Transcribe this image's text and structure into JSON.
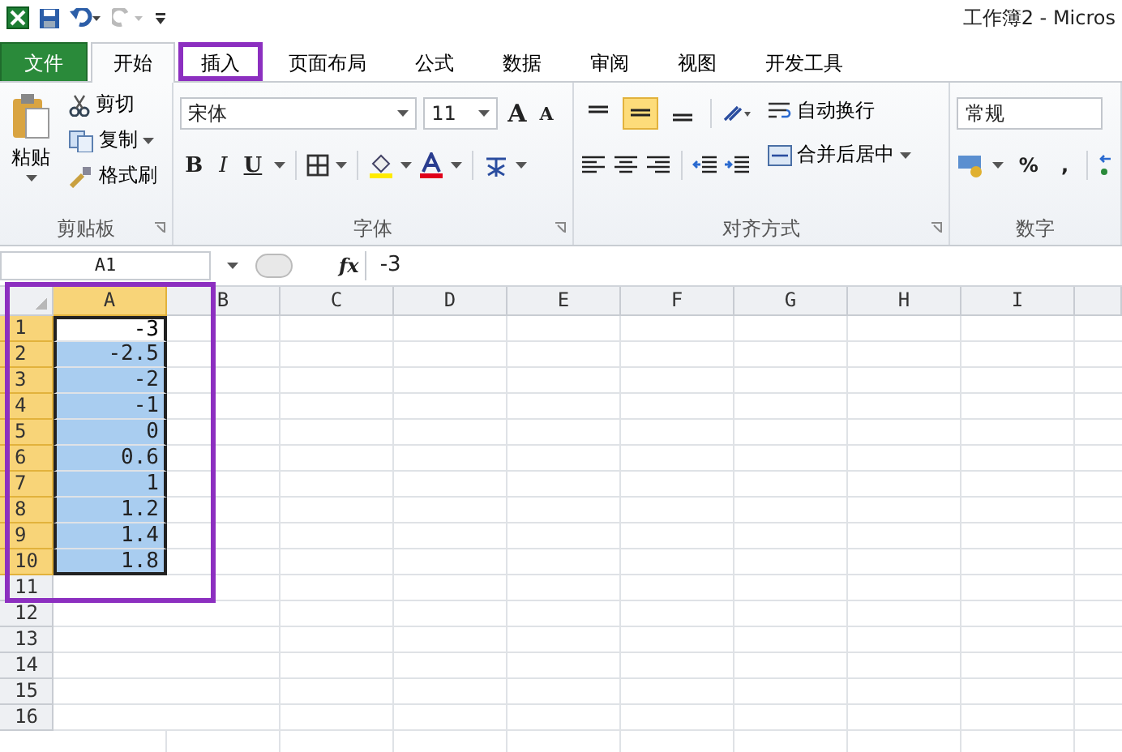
{
  "window": {
    "title": "工作簿2 - Micros"
  },
  "tabs": [
    {
      "label": "文件",
      "kind": "file",
      "selected": false,
      "highlighted": false
    },
    {
      "label": "开始",
      "kind": "tab",
      "selected": true,
      "highlighted": false
    },
    {
      "label": "插入",
      "kind": "tab",
      "selected": false,
      "highlighted": true
    },
    {
      "label": "页面布局",
      "kind": "tab",
      "selected": false,
      "highlighted": false
    },
    {
      "label": "公式",
      "kind": "tab",
      "selected": false,
      "highlighted": false
    },
    {
      "label": "数据",
      "kind": "tab",
      "selected": false,
      "highlighted": false
    },
    {
      "label": "审阅",
      "kind": "tab",
      "selected": false,
      "highlighted": false
    },
    {
      "label": "视图",
      "kind": "tab",
      "selected": false,
      "highlighted": false
    },
    {
      "label": "开发工具",
      "kind": "tab",
      "selected": false,
      "highlighted": false
    }
  ],
  "clipboard": {
    "paste": "粘贴",
    "cut": "剪切",
    "copy": "复制",
    "format_painter": "格式刷",
    "label": "剪贴板"
  },
  "font": {
    "name": "宋体",
    "size": "11",
    "grow": "A",
    "shrink": "A",
    "bold": "B",
    "italic": "I",
    "underline": "U",
    "label": "字体"
  },
  "alignment": {
    "wrap": "自动换行",
    "merge": "合并后居中",
    "label": "对齐方式",
    "align_buttons": [
      {
        "selected": false
      },
      {
        "selected": true
      },
      {
        "selected": false
      }
    ]
  },
  "number": {
    "format": "常规",
    "percent": "%",
    "comma": ",",
    "label": "数字"
  },
  "formula_bar": {
    "name_box": "A1",
    "fx": "fx",
    "value": "-3"
  },
  "sheet": {
    "columns": [
      {
        "label": "A",
        "selected": true
      },
      {
        "label": "B",
        "selected": false
      },
      {
        "label": "C",
        "selected": false
      },
      {
        "label": "D",
        "selected": false
      },
      {
        "label": "E",
        "selected": false
      },
      {
        "label": "F",
        "selected": false
      },
      {
        "label": "G",
        "selected": false
      },
      {
        "label": "H",
        "selected": false
      },
      {
        "label": "I",
        "selected": false
      }
    ],
    "highlight_frame": true,
    "rows": [
      {
        "label": "1",
        "value": "-3",
        "selected": true,
        "active": true
      },
      {
        "label": "2",
        "value": "-2.5",
        "selected": true,
        "active": false
      },
      {
        "label": "3",
        "value": "-2",
        "selected": true,
        "active": false
      },
      {
        "label": "4",
        "value": "-1",
        "selected": true,
        "active": false
      },
      {
        "label": "5",
        "value": "0",
        "selected": true,
        "active": false
      },
      {
        "label": "6",
        "value": "0.6",
        "selected": true,
        "active": false
      },
      {
        "label": "7",
        "value": "1",
        "selected": true,
        "active": false
      },
      {
        "label": "8",
        "value": "1.2",
        "selected": true,
        "active": false
      },
      {
        "label": "9",
        "value": "1.4",
        "selected": true,
        "active": false
      },
      {
        "label": "10",
        "value": "1.8",
        "selected": true,
        "active": false
      },
      {
        "label": "11",
        "value": "",
        "selected": false,
        "active": false
      },
      {
        "label": "12",
        "value": "",
        "selected": false,
        "active": false
      },
      {
        "label": "13",
        "value": "",
        "selected": false,
        "active": false
      },
      {
        "label": "14",
        "value": "",
        "selected": false,
        "active": false
      },
      {
        "label": "15",
        "value": "",
        "selected": false,
        "active": false
      },
      {
        "label": "16",
        "value": "",
        "selected": false,
        "active": false
      }
    ]
  }
}
